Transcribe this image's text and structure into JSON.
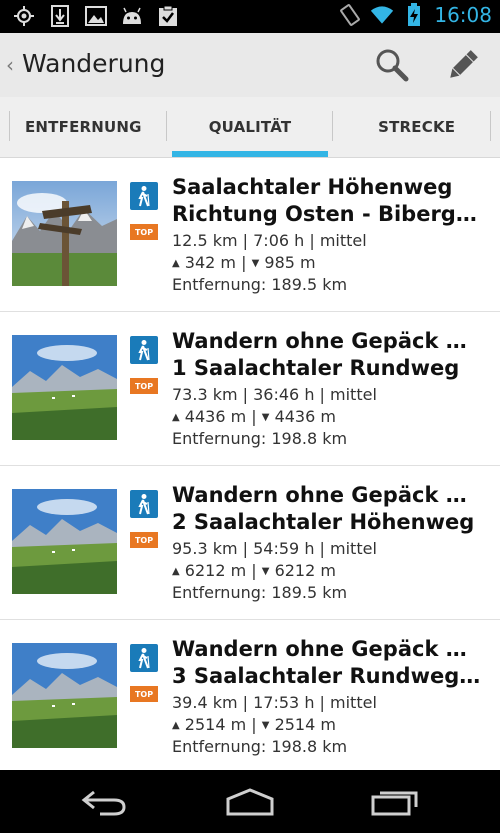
{
  "status_bar": {
    "time": "16:08",
    "left_icons": [
      "gps-icon",
      "download-icon",
      "image-icon",
      "android-icon",
      "clipboard-check-icon"
    ],
    "right_icons": [
      "screen-rotate-icon",
      "wifi-icon",
      "battery-charging-icon"
    ],
    "time_color": "#33b5e5"
  },
  "action_bar": {
    "back_glyph": "‹",
    "title": "Wanderung",
    "actions": [
      "search-icon",
      "pencil-icon"
    ]
  },
  "tabs": [
    {
      "label": "ENTFERNUNG",
      "selected": false
    },
    {
      "label": "QUALITÄT",
      "selected": true
    },
    {
      "label": "STRECKE",
      "selected": false
    }
  ],
  "accent_color": "#33b5e5",
  "badges": {
    "top_label": "TOP",
    "hike_color": "#1a7bb9",
    "top_color": "#e87722"
  },
  "routes": [
    {
      "title_line1": "Saalachtaler Höhenweg",
      "title_line2": "Richtung Osten - Biberg…",
      "stats": "12.5 km | 7:06 h | mittel",
      "ascent": "342 m",
      "descent": "985 m",
      "distance": "Entfernung: 189.5 km"
    },
    {
      "title_line1": "Wandern ohne Gepäck Route",
      "title_line2": "1 Saalachtaler Rundweg",
      "stats": "73.3 km | 36:46 h | mittel",
      "ascent": "4436 m",
      "descent": "4436 m",
      "distance": "Entfernung: 198.8 km"
    },
    {
      "title_line1": "Wandern ohne Gepäck Route",
      "title_line2": "2 Saalachtaler Höhenweg",
      "stats": "95.3 km | 54:59 h | mittel",
      "ascent": "6212 m",
      "descent": "6212 m",
      "distance": "Entfernung: 189.5 km"
    },
    {
      "title_line1": "Wandern ohne Gepäck Route",
      "title_line2": "3 Saalachtaler Rundweg…",
      "stats": "39.4 km | 17:53 h | mittel",
      "ascent": "2514 m",
      "descent": "2514 m",
      "distance": "Entfernung: 198.8 km"
    }
  ],
  "labels": {
    "up_arrow": "▲",
    "down_arrow": "▼",
    "separator": "|"
  },
  "nav_bar": [
    "back-icon",
    "home-icon",
    "recent-apps-icon"
  ]
}
